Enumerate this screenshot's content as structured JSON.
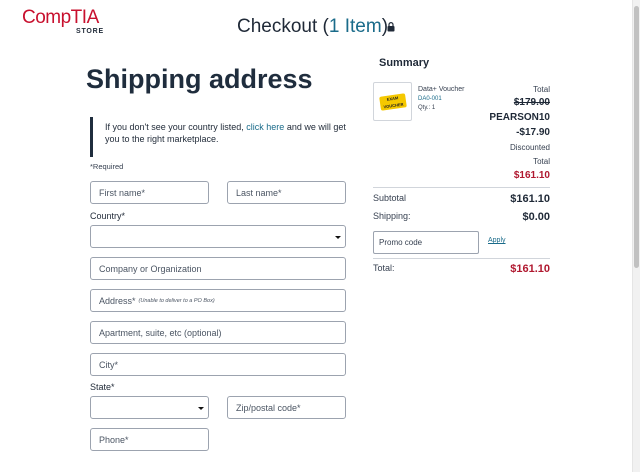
{
  "header": {
    "logo_main": "CompTIA",
    "logo_sub": "STORE",
    "checkout_text": "Checkout (",
    "item_count": "1 Item",
    "checkout_close": ")"
  },
  "shipping": {
    "heading": "Shipping address",
    "notice_before": "If you don't see your country listed, ",
    "notice_link": "click here",
    "notice_after": " and we will get you to the right marketplace.",
    "required": "*Required",
    "first_name": "First name*",
    "last_name": "Last name*",
    "country_label": "Country*",
    "country_value": "",
    "company": "Company or Organization",
    "address": "Address*",
    "address_hint": "(Unable to deliver to a PO Box)",
    "apartment": "Apartment, suite, etc (optional)",
    "city": "City*",
    "state_label": "State*",
    "state_value": "",
    "zip": "Zip/postal code*",
    "phone": "Phone*"
  },
  "summary": {
    "title": "Summary",
    "product": {
      "name": "Data+ Voucher",
      "sku": "DA0-001",
      "qty": "Qty.: 1",
      "image_text": "EXAM VOUCHER"
    },
    "total_label": "Total",
    "old_price": "$179.00",
    "promo_code": "PEARSON10",
    "discount": "-$17.90",
    "discounted_label": "Discounted",
    "discounted_total_label": "Total",
    "new_price": "$161.10",
    "subtotal_label": "Subtotal",
    "subtotal_value": "$161.10",
    "shipping_label": "Shipping:",
    "shipping_value": "$0.00",
    "promo_placeholder": "Promo code",
    "apply": "Apply",
    "grand_total_label": "Total:",
    "grand_total_value": "$161.10"
  },
  "colors": {
    "brand_red": "#c8102e",
    "link_teal": "#1a6b8a",
    "price_red": "#b0182f"
  },
  "icons": [
    "lock-icon",
    "chevron-down-icon"
  ]
}
